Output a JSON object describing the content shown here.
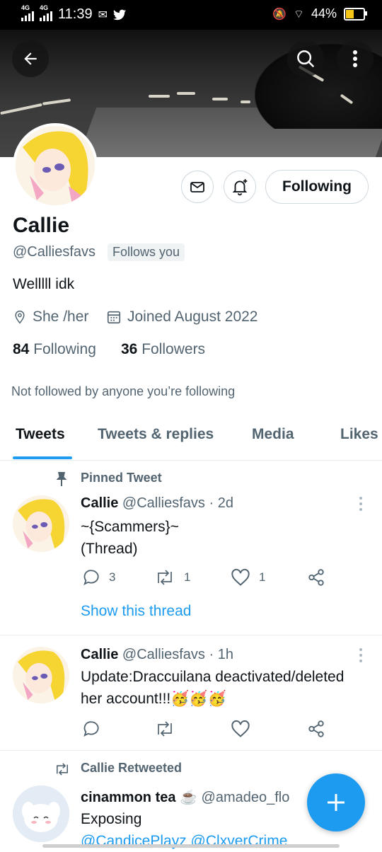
{
  "status_bar": {
    "network1": "4G",
    "network2": "4G",
    "time": "11:39",
    "battery": "44%",
    "battery_level": 0.44
  },
  "header": {
    "back_icon": "arrow-left-icon",
    "search_icon": "search-icon",
    "more_icon": "more-vertical-icon"
  },
  "profile": {
    "name": "Callie",
    "handle": "@Calliesfavs",
    "follows_you": "Follows you",
    "bio": "Welllll idk",
    "pronouns": "She /her",
    "joined": "Joined August 2022",
    "following_count": "84",
    "following_label": "Following",
    "followers_count": "36",
    "followers_label": "Followers",
    "not_followed": "Not followed by anyone you’re following",
    "following_button": "Following"
  },
  "tabs": [
    {
      "label": "Tweets",
      "active": true
    },
    {
      "label": "Tweets & replies"
    },
    {
      "label": "Media"
    },
    {
      "label": "Likes"
    }
  ],
  "tweets": [
    {
      "context": "Pinned Tweet",
      "name": "Callie",
      "handle": "@Calliesfavs",
      "time": "· 2d",
      "lines": [
        "~{Scammers}~",
        "(Thread)"
      ],
      "replies": "3",
      "retweets": "1",
      "likes": "1",
      "show_thread": "Show this thread"
    },
    {
      "name": "Callie",
      "handle": "@Calliesfavs",
      "time": "· 1h",
      "lines": [
        "Update:Draccuilana deactivated/deleted",
        "her account!!!🥳🥳🥳"
      ]
    },
    {
      "context": "Callie Retweeted",
      "name": "cinammon tea ☕",
      "handle": "@amadeo_flo",
      "lines": [
        "Exposing",
        "@CandicePlayz @ClxverCrime"
      ]
    }
  ],
  "colors": {
    "accent": "#1d9bf0",
    "text": "#0f1419",
    "muted": "#536471"
  }
}
